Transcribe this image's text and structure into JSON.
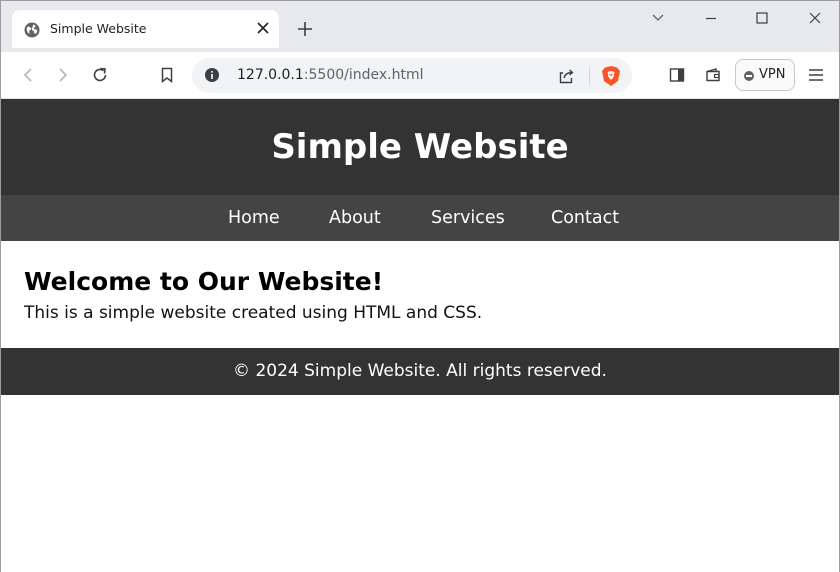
{
  "browser": {
    "tab": {
      "title": "Simple Website",
      "favicon": "globe-icon"
    },
    "url": {
      "host": "127.0.0.1",
      "rest": ":5500/index.html"
    },
    "vpn_label": "VPN",
    "icons": {
      "back": "back-arrow-icon",
      "forward": "forward-arrow-icon",
      "reload": "reload-icon",
      "bookmark": "bookmark-icon",
      "info": "site-info-icon",
      "share": "share-icon",
      "shields": "brave-shields-icon",
      "sidebar": "sidebar-icon",
      "wallet": "wallet-icon",
      "menu": "menu-icon"
    }
  },
  "page": {
    "header": {
      "title": "Simple Website"
    },
    "nav": [
      {
        "label": "Home"
      },
      {
        "label": "About"
      },
      {
        "label": "Services"
      },
      {
        "label": "Contact"
      }
    ],
    "main": {
      "heading": "Welcome to Our Website!",
      "text": "This is a simple website created using HTML and CSS."
    },
    "footer": {
      "text": "© 2024 Simple Website. All rights reserved."
    }
  },
  "colors": {
    "header_bg": "#333333",
    "nav_bg": "#444444",
    "footer_bg": "#333333",
    "brave_orange": "#fb542b"
  }
}
